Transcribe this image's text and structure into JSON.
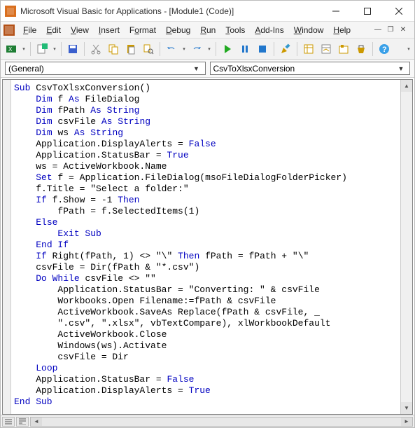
{
  "window": {
    "title": "Microsoft Visual Basic for Applications - [Module1 (Code)]"
  },
  "menu": {
    "file": "File",
    "edit": "Edit",
    "view": "View",
    "insert": "Insert",
    "format": "Format",
    "debug": "Debug",
    "run": "Run",
    "tools": "Tools",
    "addins": "Add-Ins",
    "window": "Window",
    "help": "Help"
  },
  "dropdowns": {
    "scope": "(General)",
    "proc": "CsvToXlsxConversion"
  },
  "code": {
    "lines": [
      {
        "indent": 0,
        "tokens": [
          {
            "t": "kw",
            "s": "Sub "
          },
          {
            "t": "",
            "s": "CsvToXlsxConversion()"
          }
        ]
      },
      {
        "indent": 1,
        "tokens": [
          {
            "t": "kw",
            "s": "Dim "
          },
          {
            "t": "",
            "s": "f "
          },
          {
            "t": "kw",
            "s": "As "
          },
          {
            "t": "",
            "s": "FileDialog"
          }
        ]
      },
      {
        "indent": 1,
        "tokens": [
          {
            "t": "kw",
            "s": "Dim "
          },
          {
            "t": "",
            "s": "fPath "
          },
          {
            "t": "kw",
            "s": "As String"
          }
        ]
      },
      {
        "indent": 1,
        "tokens": [
          {
            "t": "kw",
            "s": "Dim "
          },
          {
            "t": "",
            "s": "csvFile "
          },
          {
            "t": "kw",
            "s": "As String"
          }
        ]
      },
      {
        "indent": 1,
        "tokens": [
          {
            "t": "kw",
            "s": "Dim "
          },
          {
            "t": "",
            "s": "ws "
          },
          {
            "t": "kw",
            "s": "As String"
          }
        ]
      },
      {
        "indent": 1,
        "tokens": [
          {
            "t": "",
            "s": "Application.DisplayAlerts = "
          },
          {
            "t": "kw",
            "s": "False"
          }
        ]
      },
      {
        "indent": 1,
        "tokens": [
          {
            "t": "",
            "s": "Application.StatusBar = "
          },
          {
            "t": "kw",
            "s": "True"
          }
        ]
      },
      {
        "indent": 1,
        "tokens": [
          {
            "t": "",
            "s": "ws = ActiveWorkbook.Name"
          }
        ]
      },
      {
        "indent": 1,
        "tokens": [
          {
            "t": "kw",
            "s": "Set "
          },
          {
            "t": "",
            "s": "f = Application.FileDialog(msoFileDialogFolderPicker)"
          }
        ]
      },
      {
        "indent": 1,
        "tokens": [
          {
            "t": "",
            "s": "f.Title = \"Select a folder:\""
          }
        ]
      },
      {
        "indent": 1,
        "tokens": [
          {
            "t": "kw",
            "s": "If "
          },
          {
            "t": "",
            "s": "f.Show = -1 "
          },
          {
            "t": "kw",
            "s": "Then"
          }
        ]
      },
      {
        "indent": 2,
        "tokens": [
          {
            "t": "",
            "s": "fPath = f.SelectedItems(1)"
          }
        ]
      },
      {
        "indent": 1,
        "tokens": [
          {
            "t": "kw",
            "s": "Else"
          }
        ]
      },
      {
        "indent": 2,
        "tokens": [
          {
            "t": "kw",
            "s": "Exit Sub"
          }
        ]
      },
      {
        "indent": 1,
        "tokens": [
          {
            "t": "kw",
            "s": "End If"
          }
        ]
      },
      {
        "indent": 1,
        "tokens": [
          {
            "t": "kw",
            "s": "If "
          },
          {
            "t": "",
            "s": "Right(fPath, 1) <> \"\\\" "
          },
          {
            "t": "kw",
            "s": "Then "
          },
          {
            "t": "",
            "s": "fPath = fPath + \"\\\""
          }
        ]
      },
      {
        "indent": 1,
        "tokens": [
          {
            "t": "",
            "s": "csvFile = Dir(fPath & \"*.csv\")"
          }
        ]
      },
      {
        "indent": 1,
        "tokens": [
          {
            "t": "kw",
            "s": "Do While "
          },
          {
            "t": "",
            "s": "csvFile <> \"\""
          }
        ]
      },
      {
        "indent": 2,
        "tokens": [
          {
            "t": "",
            "s": "Application.StatusBar = \"Converting: \" & csvFile"
          }
        ]
      },
      {
        "indent": 2,
        "tokens": [
          {
            "t": "",
            "s": "Workbooks.Open Filename:=fPath & csvFile"
          }
        ]
      },
      {
        "indent": 2,
        "tokens": [
          {
            "t": "",
            "s": "ActiveWorkbook.SaveAs Replace(fPath & csvFile, _"
          }
        ]
      },
      {
        "indent": 2,
        "tokens": [
          {
            "t": "",
            "s": "\".csv\", \".xlsx\", vbTextCompare), xlWorkbookDefault"
          }
        ]
      },
      {
        "indent": 2,
        "tokens": [
          {
            "t": "",
            "s": "ActiveWorkbook.Close"
          }
        ]
      },
      {
        "indent": 2,
        "tokens": [
          {
            "t": "",
            "s": "Windows(ws).Activate"
          }
        ]
      },
      {
        "indent": 2,
        "tokens": [
          {
            "t": "",
            "s": "csvFile = Dir"
          }
        ]
      },
      {
        "indent": 1,
        "tokens": [
          {
            "t": "kw",
            "s": "Loop"
          }
        ]
      },
      {
        "indent": 1,
        "tokens": [
          {
            "t": "",
            "s": "Application.StatusBar = "
          },
          {
            "t": "kw",
            "s": "False"
          }
        ]
      },
      {
        "indent": 1,
        "tokens": [
          {
            "t": "",
            "s": "Application.DisplayAlerts = "
          },
          {
            "t": "kw",
            "s": "True"
          }
        ]
      },
      {
        "indent": 0,
        "tokens": [
          {
            "t": "kw",
            "s": "End Sub"
          }
        ]
      }
    ]
  }
}
